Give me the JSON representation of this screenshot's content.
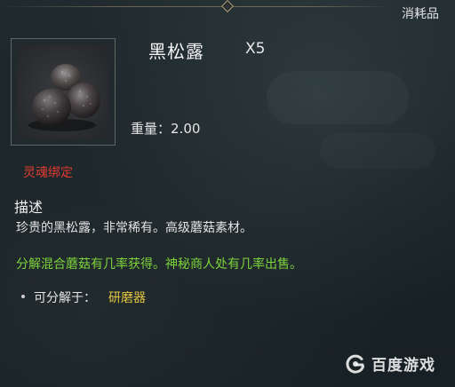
{
  "header": {
    "category": "消耗品"
  },
  "item": {
    "name": "黑松露",
    "count": "X5",
    "icon": "black-truffle-icon",
    "weight_label": "重量：",
    "weight_value": "2.00",
    "binding": "灵魂绑定"
  },
  "description": {
    "title": "描述",
    "text": "珍贵的黑松露，非常稀有。高级蘑菇素材。",
    "source": "分解混合蘑菇有几率获得。神秘商人处有几率出售。"
  },
  "salvage": {
    "label": "可分解于：",
    "value": "研磨器"
  },
  "watermark": {
    "text": "百度游戏",
    "icon": "baidu-game-logo-icon"
  },
  "colors": {
    "soulbound": "#e03a30",
    "source_text": "#7ed23c",
    "salvage_value": "#e4c640"
  }
}
